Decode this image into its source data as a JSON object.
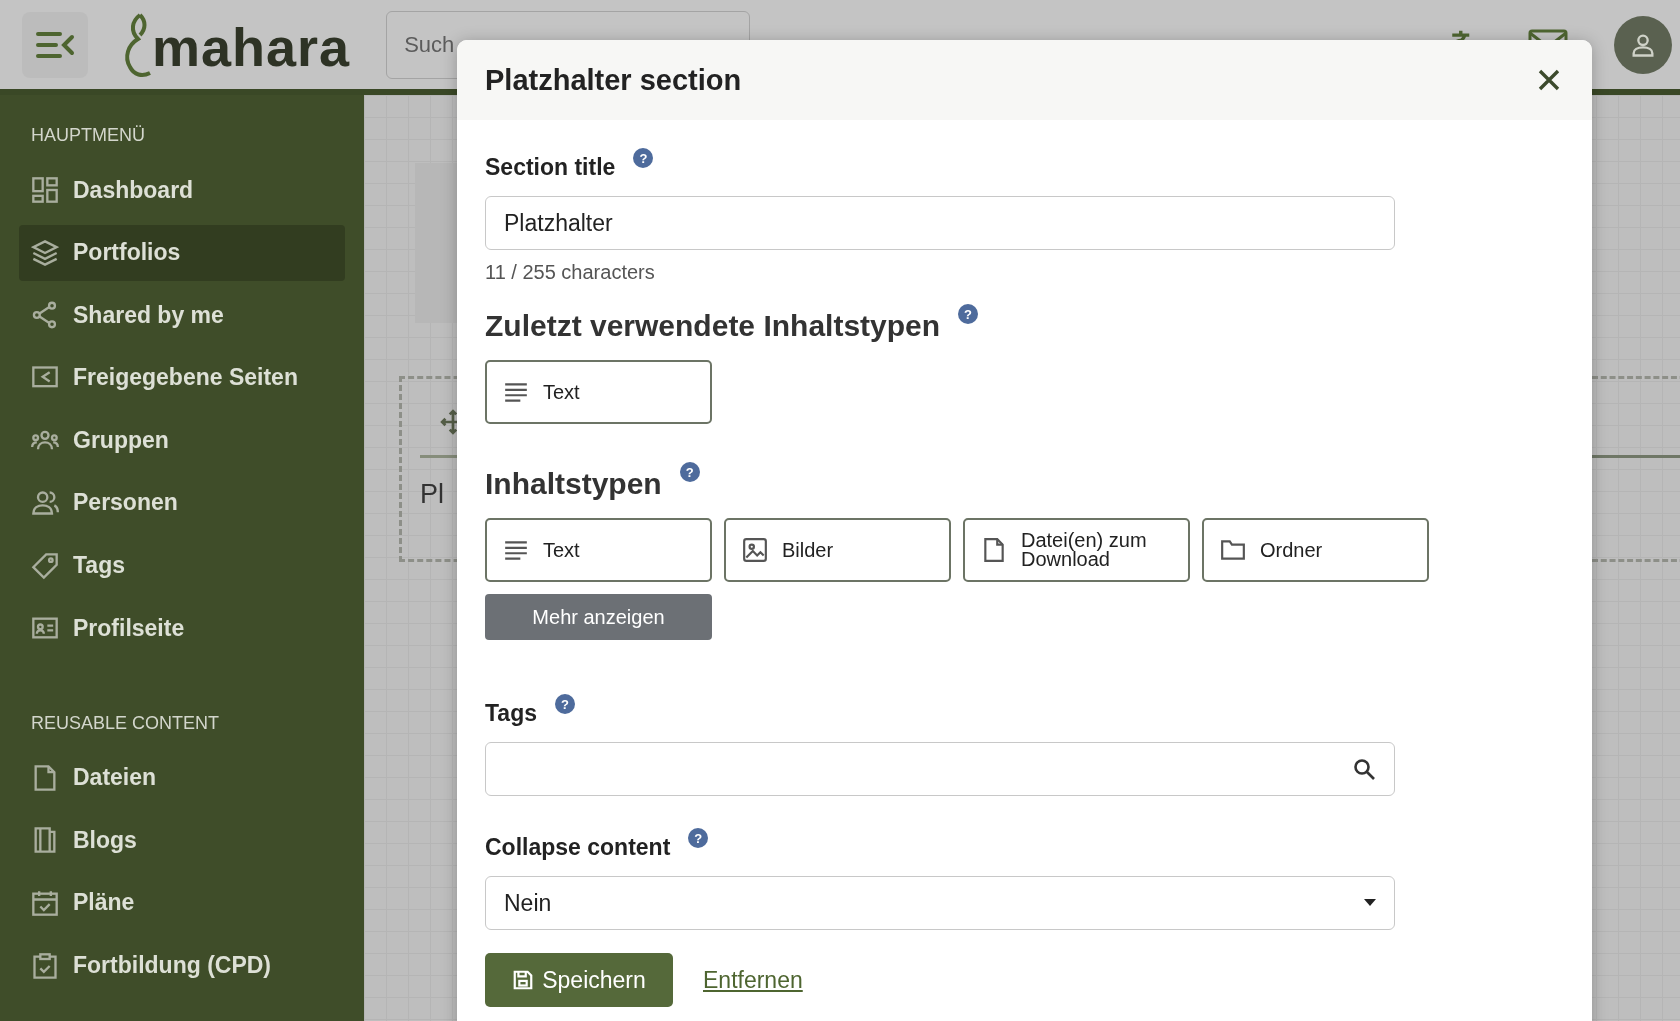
{
  "header": {
    "logo": "mahara",
    "search": {
      "placeholder": "Such"
    }
  },
  "sidebar": {
    "sections": [
      {
        "heading": "HAUPTMENÜ",
        "items": [
          {
            "label": "Dashboard",
            "selected": false
          },
          {
            "label": "Portfolios",
            "selected": true
          },
          {
            "label": "Shared by me",
            "selected": false
          },
          {
            "label": "Freigegebene Seiten",
            "selected": false
          },
          {
            "label": "Gruppen",
            "selected": false
          },
          {
            "label": "Personen",
            "selected": false
          },
          {
            "label": "Tags",
            "selected": false
          },
          {
            "label": "Profilseite",
            "selected": false
          }
        ]
      },
      {
        "heading": "REUSABLE CONTENT",
        "items": [
          {
            "label": "Dateien",
            "selected": false
          },
          {
            "label": "Blogs",
            "selected": false
          },
          {
            "label": "Pläne",
            "selected": false
          },
          {
            "label": "Fortbildung (CPD)",
            "selected": false
          }
        ]
      }
    ]
  },
  "background": {
    "block_title": "Pl"
  },
  "modal": {
    "title": "Platzhalter section",
    "section_title": {
      "label": "Section title",
      "help": "?",
      "value": "Platzhalter",
      "counter": "11 / 255 characters"
    },
    "recent": {
      "heading": "Zuletzt verwendete Inhaltstypen",
      "help": "?",
      "items": [
        {
          "label": "Text"
        }
      ]
    },
    "types": {
      "heading": "Inhaltstypen",
      "help": "?",
      "items": [
        {
          "label": "Text"
        },
        {
          "label": "Bilder"
        },
        {
          "label": "Datei(en) zum Download"
        },
        {
          "label": "Ordner"
        }
      ],
      "more": "Mehr anzeigen"
    },
    "tags": {
      "label": "Tags",
      "help": "?"
    },
    "collapse": {
      "label": "Collapse content",
      "help": "?",
      "value": "Nein"
    },
    "save": "Speichern",
    "remove": "Entfernen"
  }
}
